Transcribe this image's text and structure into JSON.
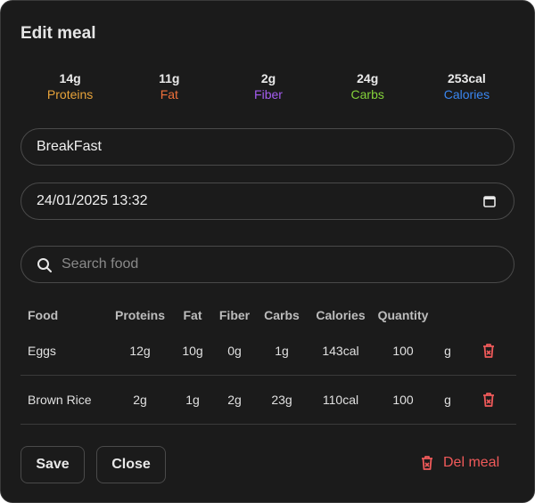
{
  "modal": {
    "title": "Edit meal"
  },
  "stats": [
    {
      "value": "14g",
      "label": "Proteins",
      "color": "#e8a33a"
    },
    {
      "value": "11g",
      "label": "Fat",
      "color": "#f0703a"
    },
    {
      "value": "2g",
      "label": "Fiber",
      "color": "#a45cf0"
    },
    {
      "value": "24g",
      "label": "Carbs",
      "color": "#84d23a"
    },
    {
      "value": "253cal",
      "label": "Calories",
      "color": "#3a86f0"
    }
  ],
  "form": {
    "meal_name": "BreakFast",
    "datetime": "24/01/2025 13:32",
    "search_placeholder": "Search food"
  },
  "table": {
    "headers": [
      "Food",
      "Proteins",
      "Fat",
      "Fiber",
      "Carbs",
      "Calories",
      "Quantity"
    ],
    "rows": [
      {
        "food": "Eggs",
        "proteins": "12g",
        "fat": "10g",
        "fiber": "0g",
        "carbs": "1g",
        "calories": "143cal",
        "quantity": "100",
        "unit": "g"
      },
      {
        "food": "Brown Rice",
        "proteins": "2g",
        "fat": "1g",
        "fiber": "2g",
        "carbs": "23g",
        "calories": "110cal",
        "quantity": "100",
        "unit": "g"
      }
    ]
  },
  "actions": {
    "save_label": "Save",
    "close_label": "Close",
    "delete_label": "Del meal",
    "danger_color": "#f05a5a"
  }
}
